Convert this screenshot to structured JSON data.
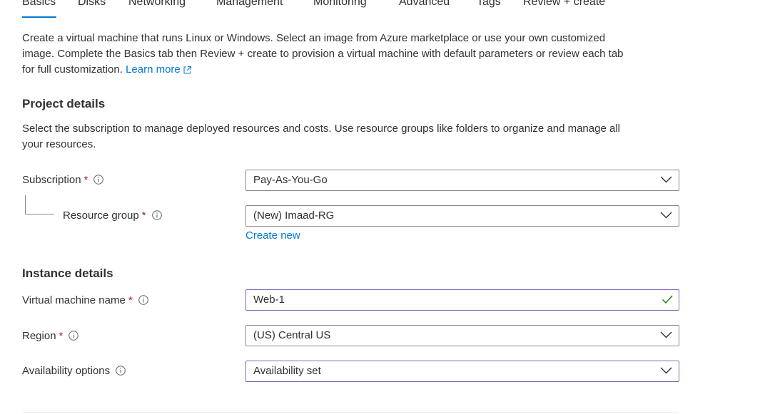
{
  "tabs": [
    {
      "label": "Basics"
    },
    {
      "label": "Disks"
    },
    {
      "label": "Networking"
    },
    {
      "label": "Management"
    },
    {
      "label": "Monitoring"
    },
    {
      "label": "Advanced"
    },
    {
      "label": "Tags"
    },
    {
      "label": "Review + create"
    }
  ],
  "intro": {
    "line1": "Create a virtual machine that runs Linux or Windows. Select an image from Azure marketplace or use your own customized",
    "line2": "image. Complete the Basics tab then Review + create to provision a virtual machine with default parameters or review each tab",
    "line3": "for full customization.",
    "learn_more": "Learn more"
  },
  "project_details": {
    "title": "Project details",
    "desc_line1": "Select the subscription to manage deployed resources and costs. Use resource groups like folders to organize and manage all",
    "desc_line2": "your resources.",
    "subscription": {
      "label": "Subscription",
      "value": "Pay-As-You-Go"
    },
    "resource_group": {
      "label": "Resource group",
      "value": "(New) Imaad-RG",
      "create_new": "Create new"
    }
  },
  "instance_details": {
    "title": "Instance details",
    "vm_name": {
      "label": "Virtual machine name",
      "value": "Web-1"
    },
    "region": {
      "label": "Region",
      "value": "(US) Central US"
    },
    "availability": {
      "label": "Availability options",
      "value": "Availability set"
    }
  },
  "required_marker": "*",
  "colors": {
    "accent": "#0078d4",
    "required": "#a4262c",
    "valid": "#107c10",
    "focus_border": "#8764b8"
  }
}
